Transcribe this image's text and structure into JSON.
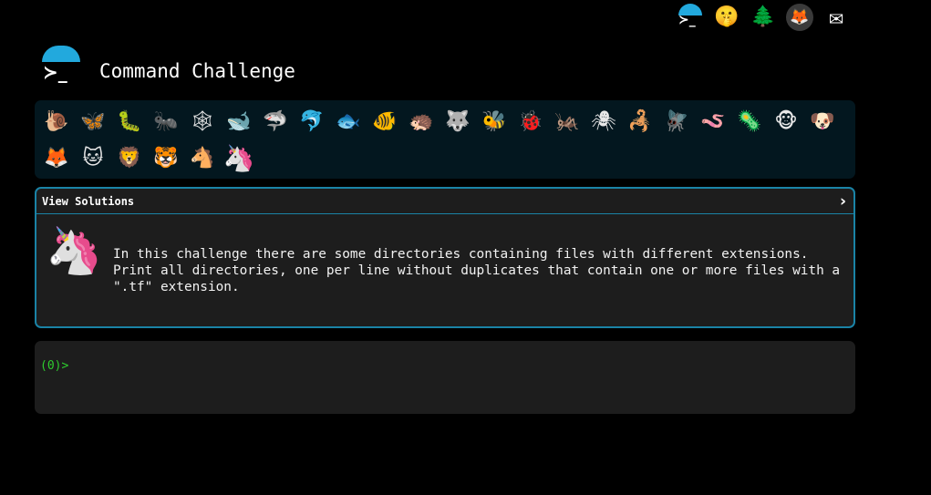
{
  "top_nav": {
    "icons": [
      {
        "name": "cmdchallenge-logo-icon",
        "glyph": "≻_"
      },
      {
        "name": "shushing-face-icon",
        "glyph": "🤫"
      },
      {
        "name": "evergreen-tree-icon",
        "glyph": "🌲"
      },
      {
        "name": "gitlab-icon",
        "glyph": "🦊"
      },
      {
        "name": "envelope-icon",
        "glyph": "✉"
      }
    ]
  },
  "header": {
    "logo_glyph": "≻_",
    "title": "Command Challenge"
  },
  "levels": [
    {
      "icon": "snail-icon",
      "glyph": "🐌"
    },
    {
      "icon": "butterfly-icon",
      "glyph": "🦋"
    },
    {
      "icon": "caterpillar-icon",
      "glyph": "🐛"
    },
    {
      "icon": "ant-icon",
      "glyph": "🐜"
    },
    {
      "icon": "spider-web-icon",
      "glyph": "🕸"
    },
    {
      "icon": "whale-icon",
      "glyph": "🐋"
    },
    {
      "icon": "shark-icon",
      "glyph": "🦈"
    },
    {
      "icon": "dolphin-icon",
      "glyph": "🐬"
    },
    {
      "icon": "fish-icon",
      "glyph": "🐟"
    },
    {
      "icon": "tropical-fish-icon",
      "glyph": "🐠"
    },
    {
      "icon": "hedgehog-icon",
      "glyph": "🦔"
    },
    {
      "icon": "wolf-icon",
      "glyph": "🐺"
    },
    {
      "icon": "bee-icon",
      "glyph": "🐝"
    },
    {
      "icon": "ladybug-icon",
      "glyph": "🐞"
    },
    {
      "icon": "cricket-icon",
      "glyph": "🦗"
    },
    {
      "icon": "spider-icon",
      "glyph": "🕷"
    },
    {
      "icon": "scorpion-icon",
      "glyph": "🦂"
    },
    {
      "icon": "fly-icon",
      "glyph": "🪰"
    },
    {
      "icon": "worm-icon",
      "glyph": "🪱"
    },
    {
      "icon": "microbe-icon",
      "glyph": "🦠"
    },
    {
      "icon": "monkey-icon",
      "glyph": "🐵"
    },
    {
      "icon": "dog-icon",
      "glyph": "🐶"
    },
    {
      "icon": "fox-icon",
      "glyph": "🦊"
    },
    {
      "icon": "cat-icon",
      "glyph": "🐱"
    },
    {
      "icon": "lion-icon",
      "glyph": "🦁"
    },
    {
      "icon": "tiger-icon",
      "glyph": "🐯"
    },
    {
      "icon": "horse-icon",
      "glyph": "🐴"
    },
    {
      "icon": "unicorn-icon",
      "glyph": "🦄",
      "current": true
    }
  ],
  "challenge": {
    "header_label": "View Solutions",
    "chevron": "›",
    "avatar_glyph": "🦄",
    "description": "In this challenge there are some directories containing files with different extensions.\nPrint all directories, one per line without duplicates that contain one or more files with a\n\".tf\" extension."
  },
  "terminal": {
    "prompt": "(0)>"
  },
  "colors": {
    "background": "#000000",
    "accent": "#22a9dd",
    "panel": "#1d1d1d",
    "level_bar": "#03171f",
    "prompt_green": "#2ecc2e"
  }
}
